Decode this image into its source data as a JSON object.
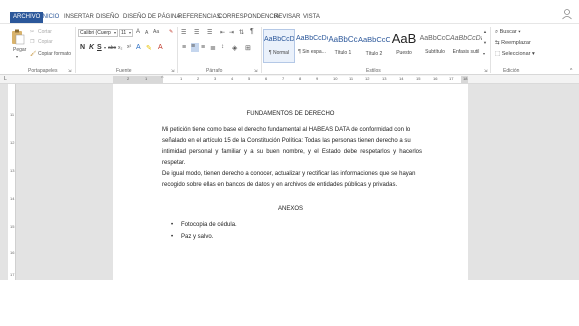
{
  "menu": {
    "tabs": [
      "ARCHIVO",
      "INICIO",
      "INSERTAR",
      "DISEÑO",
      "DISEÑO DE PÁGINA",
      "REFERENCIAS",
      "CORRESPONDENCIA",
      "REVISAR",
      "VISTA"
    ]
  },
  "clipboard": {
    "paste": "Pegar",
    "cut": "Cortar",
    "copy": "Copiar",
    "format_painter": "Copiar formato",
    "label": "Portapapeles"
  },
  "font": {
    "family": "Calibri (Cuerp",
    "size": "11",
    "bold": "N",
    "italic": "K",
    "underline": "S",
    "strike": "abc",
    "sub": "x₂",
    "sup": "x²",
    "grow": "A",
    "shrink": "A",
    "case": "Aa",
    "label": "Fuente"
  },
  "paragraph": {
    "label": "Párrafo"
  },
  "styles": {
    "label": "Estilos",
    "items": [
      {
        "sample": "AaBbCcDc",
        "name": "¶ Normal"
      },
      {
        "sample": "AaBbCcDc",
        "name": "¶ Sin espa..."
      },
      {
        "sample": "AaBbCc",
        "name": "Título 1"
      },
      {
        "sample": "AaBbCcC",
        "name": "Título 2"
      },
      {
        "sample": "AaB",
        "name": "Puesto"
      },
      {
        "sample": "AaBbCcC",
        "name": "Subtítulo"
      },
      {
        "sample": "AaBbCcDa",
        "name": "Énfasis sutil"
      }
    ]
  },
  "editing": {
    "find": "Buscar",
    "replace": "Reemplazar",
    "select": "Seleccionar",
    "label": "Edición"
  },
  "ruler": {
    "numbers": [
      "2",
      "1",
      "1",
      "2",
      "3",
      "4",
      "5",
      "6",
      "7",
      "8",
      "9",
      "10",
      "11",
      "12",
      "13",
      "14",
      "15",
      "16",
      "17",
      "18"
    ],
    "vertical_numbers": [
      "11",
      "12",
      "13",
      "14",
      "15",
      "16",
      "17"
    ]
  },
  "document": {
    "title": "FUNDAMENTOS DE DERECHO",
    "paragraph_lines": [
      "Mi petición tiene como base el derecho fundamental al HABEAS DATA de conformidad con lo",
      "señalado en el artículo 15 de la Constitución Política: Todas las personas tienen derecho a su",
      "intimidad personal y familiar y a su buen nombre, y el Estado debe respetarlos y hacerlos respetar.",
      "De igual modo, tienen derecho a conocer, actualizar y rectificar las informaciones que se hayan",
      "recogido sobre ellas en bancos de datos y en archivos de entidades públicas y privadas."
    ],
    "annex_title": "ANEXOS",
    "annex_items": [
      "Fotocopia de cédula.",
      "Paz y salvo."
    ]
  }
}
